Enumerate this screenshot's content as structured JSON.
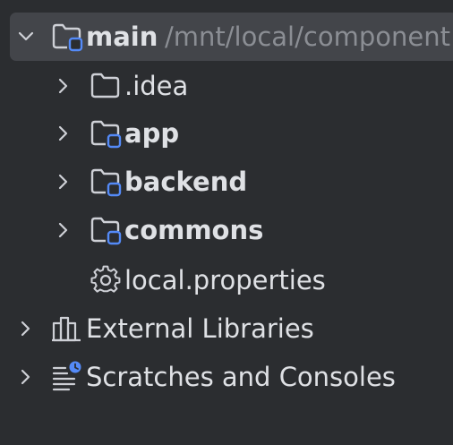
{
  "project_tree": {
    "root": {
      "name": "main",
      "path": "/mnt/local/component",
      "expanded": true,
      "icon": "module-folder-icon"
    },
    "children": [
      {
        "name": ".idea",
        "type": "folder",
        "icon": "folder-icon",
        "bold": false
      },
      {
        "name": "app",
        "type": "module",
        "icon": "module-folder-icon",
        "bold": true
      },
      {
        "name": "backend",
        "type": "module",
        "icon": "module-folder-icon",
        "bold": true
      },
      {
        "name": "commons",
        "type": "module",
        "icon": "module-folder-icon",
        "bold": true
      },
      {
        "name": "local.properties",
        "type": "file",
        "icon": "gear-icon",
        "bold": false
      }
    ],
    "external_libraries": {
      "label": "External Libraries",
      "icon": "library-icon"
    },
    "scratches": {
      "label": "Scratches and Consoles",
      "icon": "scratches-icon"
    }
  },
  "colors": {
    "background": "#2b2d30",
    "selection": "#43454a",
    "text": "#dfe1e5",
    "path_text": "#8b8e94",
    "module_badge": "#548af7",
    "icon_stroke": "#ced0d6"
  }
}
